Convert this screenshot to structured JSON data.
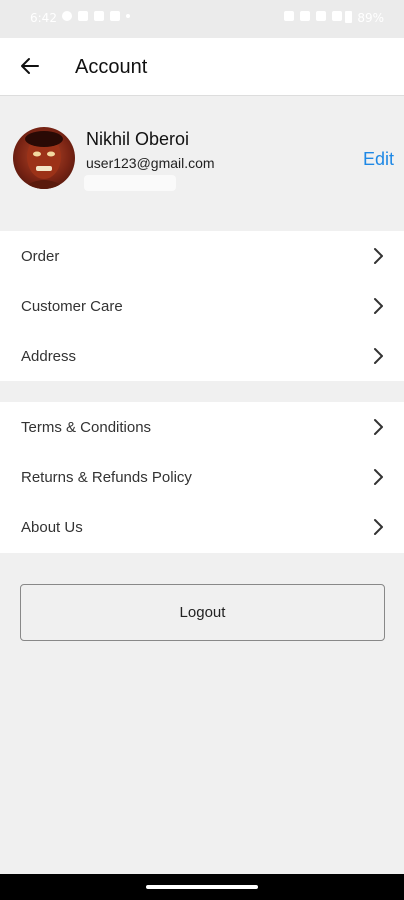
{
  "status_bar": {
    "time": "6:42",
    "battery": "89%"
  },
  "app_bar": {
    "title": "Account",
    "back_icon": "arrow-left-icon"
  },
  "profile": {
    "name": "Nikhil Oberoi",
    "email": "user123@gmail.com",
    "edit_label": "Edit",
    "accent_color": "#1e88e5"
  },
  "menu_group_1": [
    {
      "label": "Order"
    },
    {
      "label": "Customer Care"
    },
    {
      "label": "Address"
    }
  ],
  "menu_group_2": [
    {
      "label": "Terms & Conditions"
    },
    {
      "label": "Returns & Refunds Policy"
    },
    {
      "label": "About Us"
    }
  ],
  "logout": {
    "label": "Logout"
  },
  "colors": {
    "background": "#f0f0f0",
    "card": "#ffffff",
    "accent": "#1e88e5"
  }
}
